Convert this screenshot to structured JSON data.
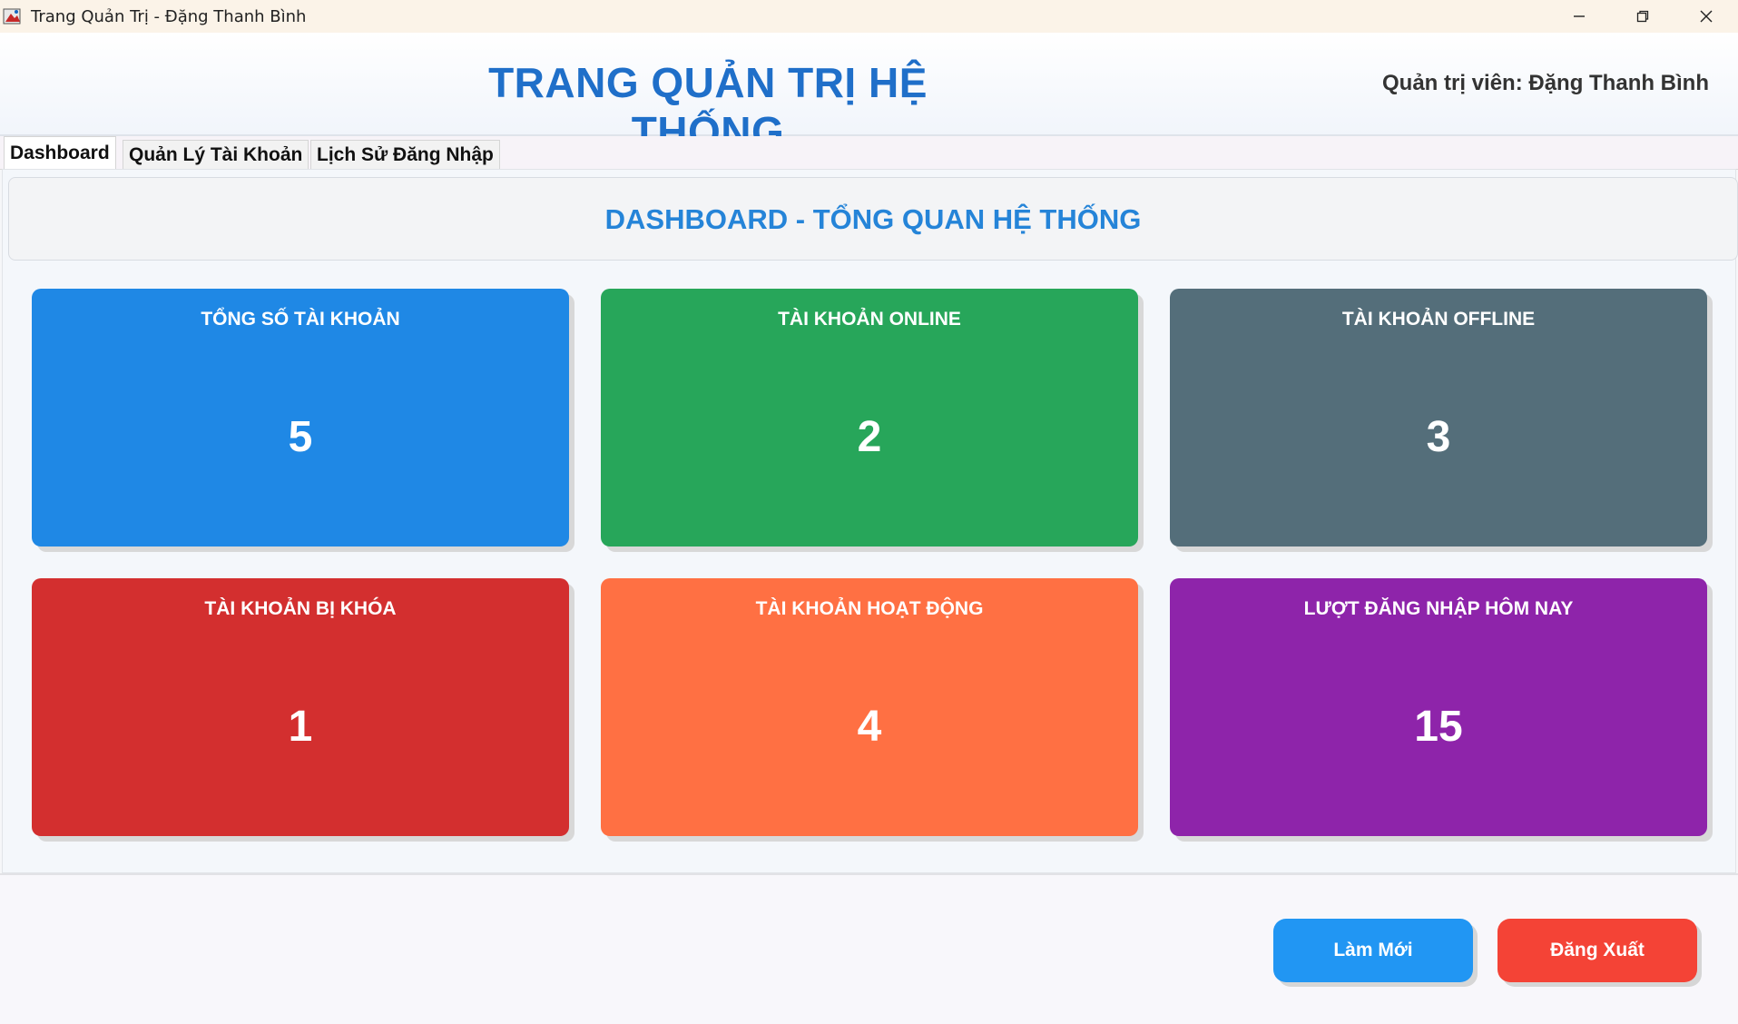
{
  "window": {
    "title": "Trang Quản Trị - Đặng Thanh Bình",
    "controls": {
      "minimize": "—",
      "restore": "❐",
      "close": "✕"
    }
  },
  "header": {
    "title": "TRANG QUẢN TRỊ HỆ THỐNG",
    "admin": "Quản trị viên: Đặng Thanh Bình"
  },
  "tabs": [
    {
      "label": "Dashboard",
      "active": true
    },
    {
      "label": "Quản Lý Tài Khoản",
      "active": false
    },
    {
      "label": "Lịch Sử Đăng Nhập",
      "active": false
    }
  ],
  "dashboard": {
    "title": "DASHBOARD - TỔNG QUAN HỆ THỐNG",
    "cards": [
      {
        "label": "TỔNG SỐ TÀI KHOẢN",
        "value": "5",
        "color": "#1f88e5"
      },
      {
        "label": "TÀI KHOẢN ONLINE",
        "value": "2",
        "color": "#27a65a"
      },
      {
        "label": "TÀI KHOẢN OFFLINE",
        "value": "3",
        "color": "#546e7a"
      },
      {
        "label": "TÀI KHOẢN BỊ KHÓA",
        "value": "1",
        "color": "#d32f2f"
      },
      {
        "label": "TÀI KHOẢN HOẠT ĐỘNG",
        "value": "4",
        "color": "#ff7043"
      },
      {
        "label": "LƯỢT ĐĂNG NHẬP HÔM NAY",
        "value": "15",
        "color": "#8e24aa"
      }
    ]
  },
  "footer": {
    "refresh_label": "Làm Mới",
    "refresh_color": "#2196f3",
    "logout_label": "Đăng Xuất",
    "logout_color": "#f44336"
  }
}
